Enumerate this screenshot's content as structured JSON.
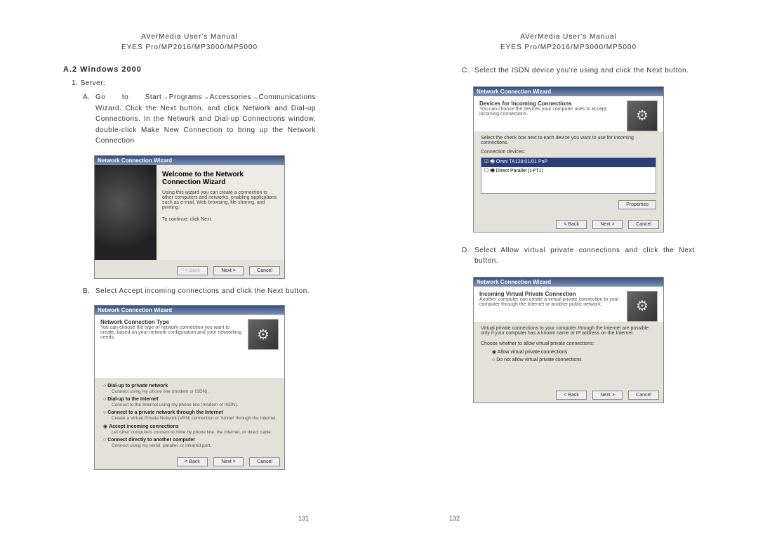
{
  "header": {
    "line1": "AVerMedia User's Manual",
    "line2": "EYES Pro/MP2016/MP3000/MP5000"
  },
  "left": {
    "section_title": "A.2 Windows 2000",
    "server_label": "1. Server:",
    "stepA": {
      "marker": "A.",
      "text": "Go to Start→Programs→Accessories→Communications Wizard. Click the Next button. and click Network and Dial-up Connections. In the Network and Dial-up Connections window, double-click Make New Connection to bring up the Network Connection"
    },
    "stepB": {
      "marker": "B.",
      "text": "Select Accept incoming connections and click the Next button."
    },
    "page_number": "131",
    "dialog1": {
      "title": "Network Connection Wizard",
      "big_title": "Welcome to the Network Connection Wizard",
      "para1": "Using this wizard you can create a connection to other computers and networks, enabling applications such as e-mail, Web browsing, file sharing, and printing.",
      "para2": "To continue, click Next.",
      "btn_back": "< Back",
      "btn_next": "Next >",
      "btn_cancel": "Cancel"
    },
    "dialog2": {
      "title": "Network Connection Wizard",
      "subtitle": "Network Connection Type",
      "subdesc": "You can choose the type of network connection you want to create, based on your network configuration and your networking needs.",
      "r1": "Dial-up to private network",
      "r1s": "Connect using my phone line (modem or ISDN).",
      "r2": "Dial-up to the Internet",
      "r2s": "Connect to the Internet using my phone line (modem or ISDN).",
      "r3": "Connect to a private network through the Internet",
      "r3s": "Create a Virtual Private Network (VPN) connection or 'tunnel' through the Internet.",
      "r4": "Accept incoming connections",
      "r4s": "Let other computers connect to mine by phone line, the Internet, or direct cable.",
      "r5": "Connect directly to another computer",
      "r5s": "Connect using my serial, parallel, or infrared port.",
      "btn_back": "< Back",
      "btn_next": "Next >",
      "btn_cancel": "Cancel"
    }
  },
  "right": {
    "stepC": {
      "marker": "C.",
      "text": "Select the ISDN device you're using and click the Next button."
    },
    "stepD": {
      "marker": "D.",
      "text": "Select Allow virtual private connections and click the Next button."
    },
    "page_number": "132",
    "dialog3": {
      "title": "Network Connection Wizard",
      "subtitle": "Devices for Incoming Connections",
      "subdesc": "You can choose the devices your computer uses to accept incoming connections.",
      "label": "Select the check box next to each device you want to use for incoming connections.",
      "devlabel": "Connection devices:",
      "item1": "Omni TA128:01/01 PnP",
      "item2": "Direct Parallel (LPT1)",
      "btn_props": "Properties",
      "btn_back": "< Back",
      "btn_next": "Next >",
      "btn_cancel": "Cancel"
    },
    "dialog4": {
      "title": "Network Connection Wizard",
      "subtitle": "Incoming Virtual Private Connection",
      "subdesc": "Another computer can create a virtual private connection to your computer through the Internet or another public network.",
      "para": "Virtual private connections to your computer through the Internet are possible only if your computer has a known name or IP address on the Internet.",
      "choose": "Choose whether to allow virtual private connections:",
      "r1": "Allow virtual private connections",
      "r2": "Do not allow virtual private connections",
      "btn_back": "< Back",
      "btn_next": "Next >",
      "btn_cancel": "Cancel"
    }
  }
}
